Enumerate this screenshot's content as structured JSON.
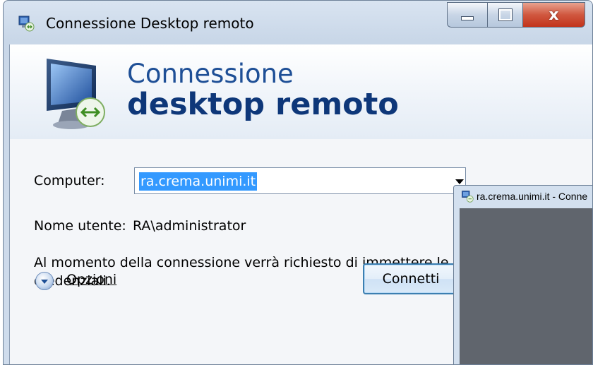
{
  "window": {
    "title": "Connessione Desktop remoto",
    "close_glyph": "x"
  },
  "banner": {
    "line1": "Connessione",
    "line2": "desktop remoto",
    "icon": "monitor-remote-icon"
  },
  "form": {
    "computer_label": "Computer:",
    "computer_value": "ra.crema.unimi.it",
    "username_label": "Nome utente:",
    "username_value": "RA\\administrator",
    "info_line1": "Al momento della connessione verrà richiesto di immettere le",
    "info_line2": "credenziali.",
    "options_label": "Opzioni",
    "connect_label": "Connetti"
  },
  "second_window": {
    "title": "ra.crema.unimi.it - Conne"
  },
  "colors": {
    "banner_title": "#0e3779",
    "selection": "#3399ff",
    "rdp_body": "#60656d",
    "close_button": "#c2331b"
  }
}
